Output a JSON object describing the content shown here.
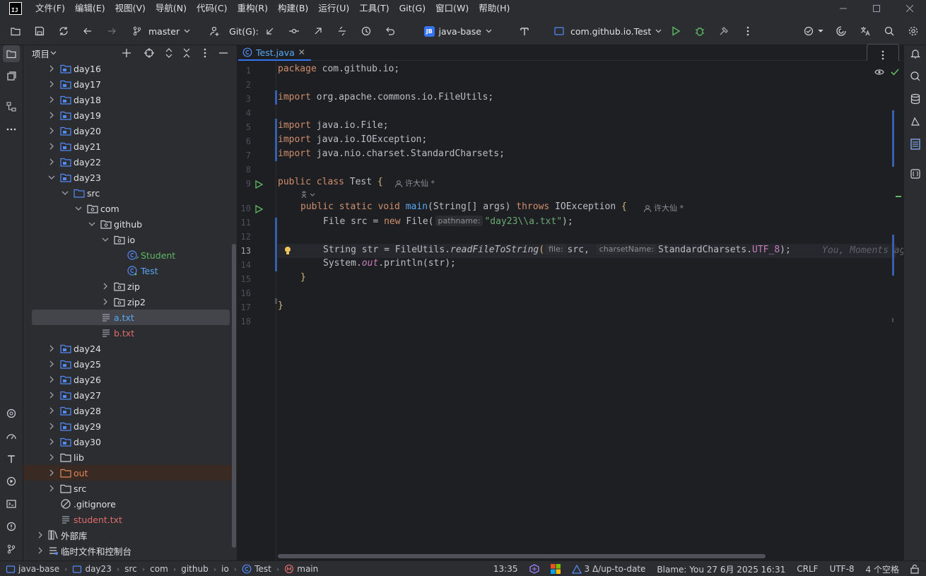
{
  "menu": [
    "文件(F)",
    "编辑(E)",
    "视图(V)",
    "导航(N)",
    "代码(C)",
    "重构(R)",
    "构建(B)",
    "运行(U)",
    "工具(T)",
    "Git(G)",
    "窗口(W)",
    "帮助(H)"
  ],
  "app_logo": "IJ",
  "toolbar": {
    "branch": "master",
    "git_label": "Git(G):",
    "project_badge": "JB",
    "project_name": "java-base",
    "run_config": "com.github.io.Test"
  },
  "project_panel": {
    "title": "项目",
    "tree": [
      {
        "label": "day16"
      },
      {
        "label": "day17"
      },
      {
        "label": "day18"
      },
      {
        "label": "day19"
      },
      {
        "label": "day20"
      },
      {
        "label": "day21"
      },
      {
        "label": "day22"
      },
      {
        "label": "day23"
      },
      {
        "label": "src"
      },
      {
        "label": "com"
      },
      {
        "label": "github"
      },
      {
        "label": "io"
      },
      {
        "label": "Student"
      },
      {
        "label": "Test"
      },
      {
        "label": "zip"
      },
      {
        "label": "zip2"
      },
      {
        "label": "a.txt"
      },
      {
        "label": "b.txt"
      },
      {
        "label": "day24"
      },
      {
        "label": "day25"
      },
      {
        "label": "day26"
      },
      {
        "label": "day27"
      },
      {
        "label": "day28"
      },
      {
        "label": "day29"
      },
      {
        "label": "day30"
      },
      {
        "label": "lib"
      },
      {
        "label": "out"
      },
      {
        "label": "src"
      },
      {
        "label": ".gitignore"
      },
      {
        "label": "student.txt"
      },
      {
        "label": "外部库"
      },
      {
        "label": "临时文件和控制台"
      }
    ]
  },
  "editor": {
    "tab_name": "Test.java",
    "line_numbers": [
      "1",
      "2",
      "3",
      "4",
      "5",
      "6",
      "7",
      "8",
      "9",
      "10",
      "11",
      "12",
      "13",
      "14",
      "15",
      "16",
      "17",
      "18"
    ],
    "code": {
      "l1_kw": "package",
      "l1_rest": " com.github.io;",
      "l3_kw": "import",
      "l3_rest": " org.apache.commons.io.FileUtils;",
      "l5_kw": "import",
      "l5_rest": " java.io.File;",
      "l6_kw": "import",
      "l6_rest": " java.io.IOException;",
      "l7_kw": "import",
      "l7_rest": " java.nio.charset.StandardCharsets;",
      "l9_kw": "public class",
      "l9_rest": " Test ",
      "l9_brace": "{",
      "l10_kw1": "public static void",
      "l10_fn": "main",
      "l10_mid": "(String[] args) ",
      "l10_kw2": "throws",
      "l10_rest": " IOException ",
      "l10_brace": "{",
      "l11_a": "File src = ",
      "l11_kw": "new",
      "l11_b": " File(",
      "l11_hint": "pathname:",
      "l11_str": "\"day23\\\\a.txt\"",
      "l11_c": ");",
      "l13_a": "String str = FileUtils.",
      "l13_fn": "readFileToString",
      "l13_p": "(",
      "l13_hint1": "file:",
      "l13_b": "src, ",
      "l13_hint2": "charsetName:",
      "l13_c": "StandardCharsets.",
      "l13_fld": "UTF_8",
      "l13_d": ");",
      "l14_a": "System.",
      "l14_fld": "out",
      "l14_b": ".println(str);",
      "l15": "}",
      "l17": "}"
    },
    "author_class": "许大仙 *",
    "author_method": "许大仙 *",
    "inline_blame": "You, Moments ag"
  },
  "status": {
    "breadcrumbs": [
      "java-base",
      "day23",
      "src",
      "com",
      "github",
      "io",
      "Test",
      "main"
    ],
    "caret": "13:35",
    "vcs": "3 Δ/up-to-date",
    "blame": "Blame: You 27 6月 2025 16:31",
    "line_sep": "CRLF",
    "encoding": "UTF-8",
    "indent": "4 个空格"
  },
  "colors": {
    "accent": "#3574f0",
    "folder_icon": "#548af7",
    "class_icon": "#548af7",
    "run_green": "#5fb865",
    "string": "#6aab73",
    "keyword": "#cf8e6d",
    "function": "#56a8f5"
  }
}
